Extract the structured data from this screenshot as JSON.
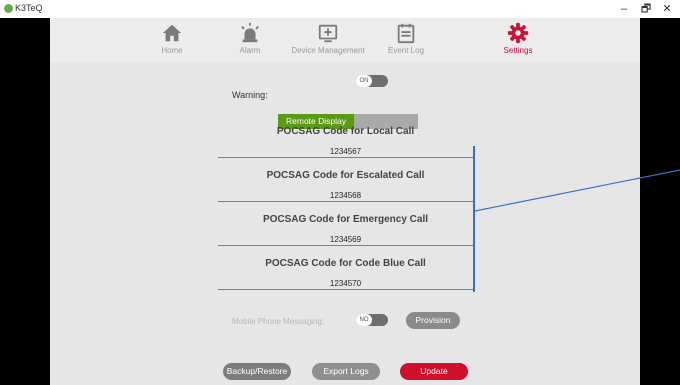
{
  "window": {
    "title": "K3TeQ",
    "minimize": "–",
    "restore": "🗗",
    "close": "✕"
  },
  "nav": {
    "items": [
      {
        "label": "Home",
        "icon": "home-icon"
      },
      {
        "label": "Alarm",
        "icon": "alarm-icon"
      },
      {
        "label": "Device Management",
        "icon": "device-management-icon"
      },
      {
        "label": "Event Log",
        "icon": "event-log-icon"
      },
      {
        "label": "Settings",
        "icon": "settings-icon"
      }
    ],
    "active": "Settings",
    "active_color": "#cc1133"
  },
  "settings": {
    "warning_label": "Warning:",
    "warning_toggle": "ON",
    "remote_display_label": "Remote Display",
    "codes": [
      {
        "title": "POCSAG Code for Local Call",
        "value": "1234567"
      },
      {
        "title": "POCSAG Code for Escalated Call",
        "value": "1234568"
      },
      {
        "title": "POCSAG Code for Emergency Call",
        "value": "1234569"
      },
      {
        "title": "POCSAG Code for Code Blue Call",
        "value": "1234570"
      }
    ],
    "mobile_label": "Mobile Phone Messaging:",
    "mobile_toggle": "NO",
    "provision_button": "Provision"
  },
  "footer": {
    "backup_button": "Backup/Restore",
    "export_button": "Export Logs",
    "update_button": "Update"
  },
  "colors": {
    "accent": "#cc1133",
    "remote_display": "#5a9a14",
    "annotation": "#3b6ecc"
  }
}
